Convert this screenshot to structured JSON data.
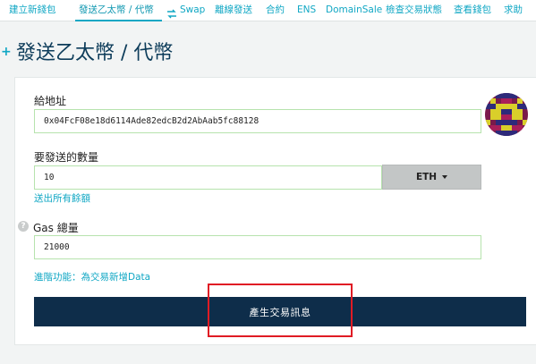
{
  "nav": {
    "items": [
      {
        "label": "建立新錢包",
        "active": false
      },
      {
        "label": "發送乙太幣 / 代幣",
        "active": true
      },
      {
        "label": "Swap",
        "active": false
      },
      {
        "label": "離線發送",
        "active": false
      },
      {
        "label": "合約",
        "active": false
      },
      {
        "label": "ENS",
        "active": false
      },
      {
        "label": "DomainSale",
        "active": false
      },
      {
        "label": "檢查交易狀態",
        "active": false
      },
      {
        "label": "查看錢包",
        "active": false
      },
      {
        "label": "求助",
        "active": false
      }
    ]
  },
  "page": {
    "title_prefix": "+",
    "title": "發送乙太幣 / 代幣"
  },
  "form": {
    "to_label": "給地址",
    "to_value": "0x04FcF08e18d6114Ade82edcB2d2AbAab5fc88128",
    "amount_label": "要發送的數量",
    "amount_value": "10",
    "unit": "ETH",
    "send_all_link": "送出所有餘額",
    "gas_label": "Gas 總量",
    "gas_value": "21000",
    "advanced_link": "進階功能：為交易新增Data",
    "generate_button": "產生交易訊息"
  },
  "colors": {
    "accent": "#10a7c4",
    "title": "#0d3c5a",
    "button_bg": "#0e2d4a",
    "input_border": "#b6e3ad",
    "highlight": "#e01b24"
  },
  "icons": {
    "swap": "swap-icon",
    "help": "help-icon",
    "avatar": "identicon-avatar"
  }
}
